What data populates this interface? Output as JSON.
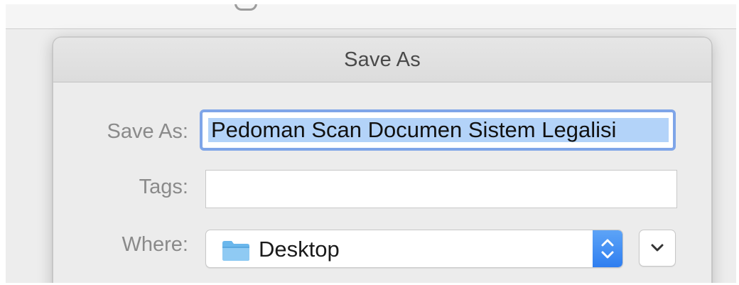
{
  "dialog": {
    "title": "Save As"
  },
  "form": {
    "save_as_label": "Save As:",
    "save_as_value": "Pedoman Scan Documen Sistem Legalisi",
    "tags_label": "Tags:",
    "tags_value": "",
    "where_label": "Where:",
    "where_value": "Desktop"
  },
  "icons": {
    "folder": "folder-icon",
    "stepper": "up-down-chevron-icon",
    "expand": "chevron-down-icon"
  },
  "colors": {
    "focus_ring": "#7fa5e8",
    "selection": "#b3d3f9",
    "stepper_blue": "#2f7ef0"
  }
}
